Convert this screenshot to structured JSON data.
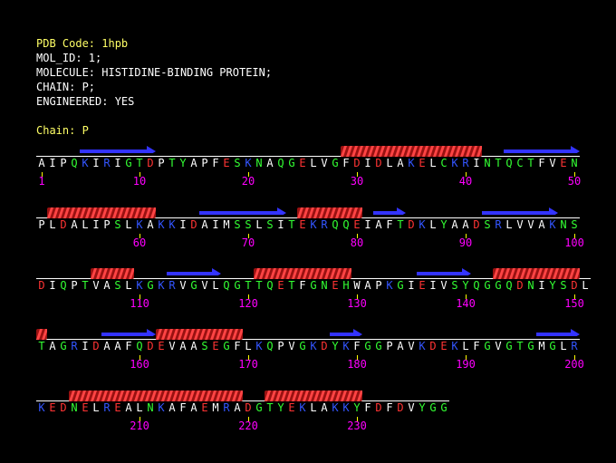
{
  "header": {
    "pdb_code": "PDB Code: 1hpb",
    "mol_id": "MOL_ID: 1;",
    "molecule": "MOLECULE: HISTIDINE-BINDING PROTEIN;",
    "chain": "CHAIN: P;",
    "engineered": "ENGINEERED: YES"
  },
  "chain_label": "Chain: P",
  "colors": {
    "header_title": "#ffff66",
    "text": "#ffffff",
    "strand": "#3333ff",
    "helix": "#ff4444",
    "number": "#ff00ff",
    "acidic": "#ff3333",
    "basic": "#3355ff",
    "polar": "#33ff33",
    "hydrophobic": "#ffffff"
  },
  "rows": [
    {
      "sequence": "AIPQKIRIGTDPTYAPFESKNAQGELVGFDIDLAKELCKRINTQCTFVEN",
      "numbers": [
        "1",
        "10",
        "20",
        "30",
        "40",
        "50"
      ],
      "strands": [
        [
          4,
          10
        ],
        [
          43,
          49
        ]
      ],
      "helices": [
        [
          28,
          40
        ]
      ]
    },
    {
      "sequence": "PLDALIPSLKAKKIDAIMSSLSITEKRQQEIAFTDKLYAADSRLVVAKNS",
      "numbers": [
        "60",
        "70",
        "80",
        "90",
        "100"
      ],
      "strands": [
        [
          15,
          22
        ],
        [
          31,
          33
        ],
        [
          41,
          47
        ]
      ],
      "helices": [
        [
          1,
          10
        ],
        [
          24,
          29
        ]
      ]
    },
    {
      "sequence": "DIQPTVASLKGKRVGVLQGTTQETFGNEHWAPKGIEIVSYQGGQDNIYSDL",
      "numbers": [
        "110",
        "120",
        "130",
        "140",
        "150"
      ],
      "strands": [
        [
          12,
          16
        ],
        [
          35,
          39
        ]
      ],
      "helices": [
        [
          5,
          8
        ],
        [
          20,
          28
        ],
        [
          42,
          49
        ]
      ]
    },
    {
      "sequence": "TAGRIDAAFQDEVAASEGFLKQPVGKDYKFGGPAVKDEKLFGVGTGMGLR",
      "numbers": [
        "160",
        "170",
        "180",
        "190",
        "200"
      ],
      "strands": [
        [
          6,
          10
        ],
        [
          27,
          29
        ],
        [
          46,
          49
        ]
      ],
      "helices": [
        [
          0,
          0
        ],
        [
          11,
          18
        ]
      ]
    },
    {
      "sequence": "KEDNELREALNKAFAEMRADGTYEKLAKKYFDFDVYGG",
      "numbers": [
        "210",
        "220",
        "230"
      ],
      "strands": [],
      "helices": [
        [
          3,
          18
        ],
        [
          21,
          29
        ]
      ]
    }
  ]
}
